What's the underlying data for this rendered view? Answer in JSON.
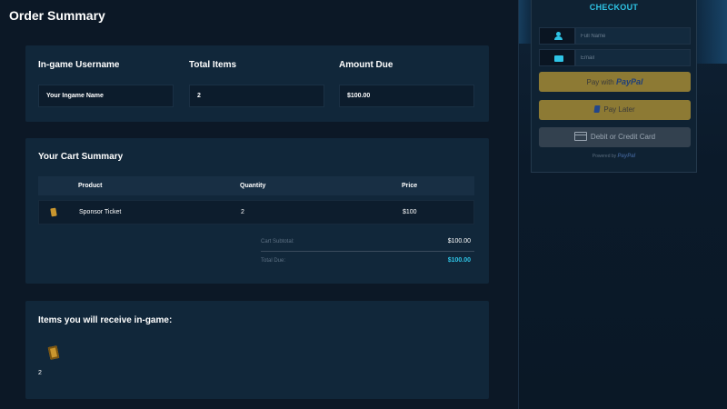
{
  "page": {
    "title": "Order Summary"
  },
  "summary": {
    "username_label": "In-game Username",
    "username_value": "Your Ingame Name",
    "items_label": "Total Items",
    "items_value": "2",
    "amount_label": "Amount Due",
    "amount_value": "$100.00"
  },
  "cart": {
    "title": "Your Cart Summary",
    "columns": [
      "Product",
      "Quantity",
      "Price"
    ],
    "rows": [
      {
        "icon": "ticket-icon",
        "product": "Sponsor Ticket",
        "quantity": "2",
        "price": "$100"
      }
    ],
    "subtotal_label": "Cart Subtotal:",
    "subtotal_value": "$100.00",
    "total_label": "Total Due:",
    "total_value": "$100.00"
  },
  "rewards": {
    "title": "Items you will receive in-game:",
    "items": [
      {
        "icon": "ticket-icon",
        "count": "2"
      }
    ]
  },
  "checkout": {
    "title": "CHECKOUT",
    "name_placeholder": "Full Name",
    "email_placeholder": "Email",
    "pay_with": "Pay with",
    "paypal": "PayPal",
    "pay_later": "Pay Later",
    "card": "Debit or Credit Card",
    "powered_by": "Powered by",
    "powered_brand": "PayPal"
  },
  "colors": {
    "accent": "#2ec4e6",
    "paypal_gold": "#8d7a34",
    "background": "#0c1826",
    "card": "#11273a"
  }
}
